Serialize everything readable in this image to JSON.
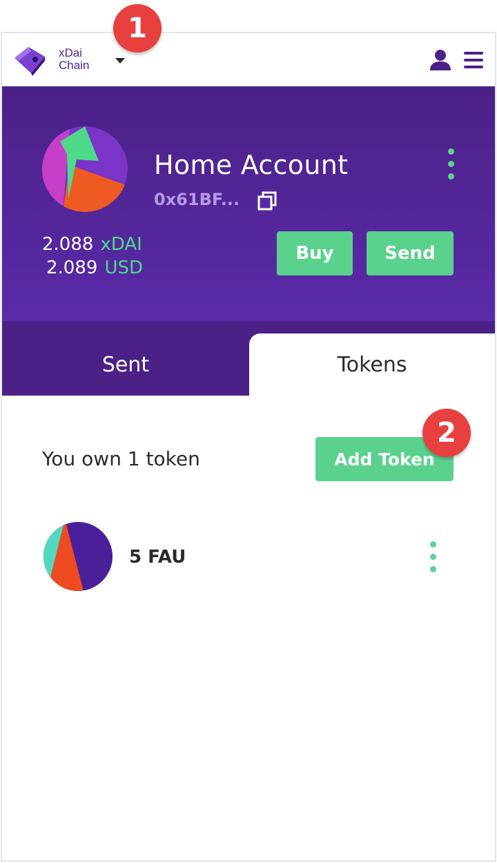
{
  "header": {
    "network_name": "xDai Chain",
    "icons": [
      "wallet-logo-icon",
      "caret-down-icon",
      "account-icon",
      "menu-icon"
    ]
  },
  "account": {
    "name": "Home Account",
    "address": "0x61BF...",
    "balance_amount": "2.088",
    "balance_unit": "xDAI",
    "usd_amount": "2.089",
    "usd_unit": "USD",
    "buy_label": "Buy",
    "send_label": "Send"
  },
  "tabs": [
    {
      "label": "Sent",
      "active": false
    },
    {
      "label": "Tokens",
      "active": true
    }
  ],
  "tokens_panel": {
    "owned_text": "You own 1 token",
    "add_token_label": "Add Token",
    "tokens": [
      {
        "label": "5 FAU"
      }
    ]
  },
  "annotations": {
    "badge_1": "1",
    "badge_2": "2"
  },
  "colors": {
    "primary_purple": "#4b2187",
    "accent_green": "#5ad18c",
    "badge_red": "#e83f3f",
    "address_lavender": "#b59ae6"
  }
}
